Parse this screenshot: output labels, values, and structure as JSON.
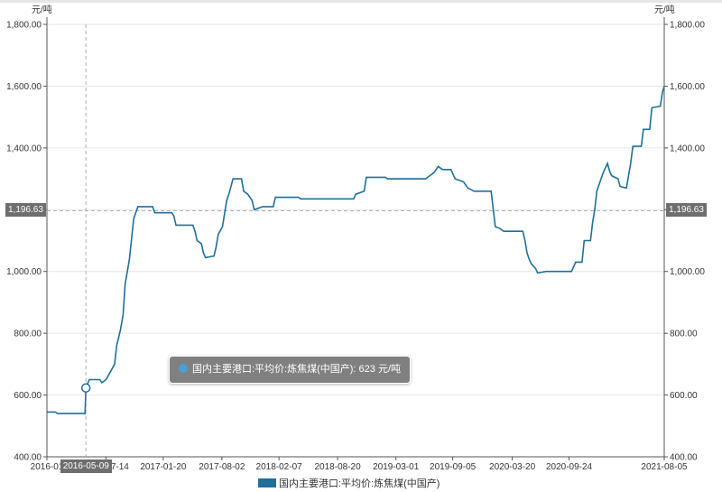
{
  "chart_data": {
    "type": "line",
    "y_unit_left": "元/吨",
    "y_unit_right": "元/吨",
    "ylim": [
      400,
      1800
    ],
    "y_ticks": [
      "400.00",
      "600.00",
      "800.00",
      "1,000.00",
      "1,200.00",
      "1,400.00",
      "1,600.00",
      "1,800.00"
    ],
    "x_ticks": [
      "2016-01",
      "2016-07-14",
      "2017-01-20",
      "2017-08-02",
      "2018-02-07",
      "2018-08-20",
      "2019-03-01",
      "2019-09-05",
      "2020-03-20",
      "2020-09-24",
      "2021-08-05"
    ],
    "x_range": [
      "2016-01-01",
      "2021-08-05"
    ],
    "grid": true,
    "legend_position": "bottom-center",
    "series": [
      {
        "name": "国内主要港口:平均价:炼焦煤(中国产)",
        "color": "#1f6f9c",
        "points": [
          [
            "2016-01-01",
            545
          ],
          [
            "2016-01-29",
            545
          ],
          [
            "2016-02-05",
            540
          ],
          [
            "2016-05-06",
            540
          ],
          [
            "2016-05-09",
            623
          ],
          [
            "2016-05-20",
            650
          ],
          [
            "2016-06-24",
            650
          ],
          [
            "2016-07-01",
            640
          ],
          [
            "2016-07-15",
            650
          ],
          [
            "2016-07-29",
            675
          ],
          [
            "2016-08-12",
            700
          ],
          [
            "2016-08-19",
            760
          ],
          [
            "2016-08-31",
            810
          ],
          [
            "2016-09-09",
            860
          ],
          [
            "2016-09-16",
            960
          ],
          [
            "2016-09-23",
            1000
          ],
          [
            "2016-09-30",
            1040
          ],
          [
            "2016-10-14",
            1170
          ],
          [
            "2016-10-21",
            1190
          ],
          [
            "2016-10-28",
            1210
          ],
          [
            "2016-12-16",
            1210
          ],
          [
            "2016-12-23",
            1190
          ],
          [
            "2017-02-17",
            1190
          ],
          [
            "2017-02-24",
            1180
          ],
          [
            "2017-03-03",
            1150
          ],
          [
            "2017-04-28",
            1150
          ],
          [
            "2017-05-05",
            1130
          ],
          [
            "2017-05-12",
            1100
          ],
          [
            "2017-05-26",
            1090
          ],
          [
            "2017-06-02",
            1060
          ],
          [
            "2017-06-09",
            1045
          ],
          [
            "2017-07-07",
            1050
          ],
          [
            "2017-07-14",
            1080
          ],
          [
            "2017-07-21",
            1120
          ],
          [
            "2017-08-04",
            1145
          ],
          [
            "2017-08-18",
            1230
          ],
          [
            "2017-08-25",
            1250
          ],
          [
            "2017-09-08",
            1300
          ],
          [
            "2017-10-06",
            1300
          ],
          [
            "2017-10-13",
            1260
          ],
          [
            "2017-10-27",
            1250
          ],
          [
            "2017-11-10",
            1230
          ],
          [
            "2017-11-17",
            1200
          ],
          [
            "2017-12-15",
            1210
          ],
          [
            "2018-01-19",
            1210
          ],
          [
            "2018-01-26",
            1240
          ],
          [
            "2018-04-13",
            1240
          ],
          [
            "2018-04-20",
            1235
          ],
          [
            "2018-10-12",
            1235
          ],
          [
            "2018-10-19",
            1250
          ],
          [
            "2018-11-16",
            1260
          ],
          [
            "2018-11-23",
            1305
          ],
          [
            "2019-01-25",
            1305
          ],
          [
            "2019-02-01",
            1300
          ],
          [
            "2019-06-07",
            1300
          ],
          [
            "2019-06-21",
            1310
          ],
          [
            "2019-07-05",
            1320
          ],
          [
            "2019-07-19",
            1340
          ],
          [
            "2019-08-02",
            1330
          ],
          [
            "2019-08-30",
            1330
          ],
          [
            "2019-09-13",
            1300
          ],
          [
            "2019-10-11",
            1290
          ],
          [
            "2019-10-25",
            1270
          ],
          [
            "2019-11-15",
            1260
          ],
          [
            "2020-01-10",
            1260
          ],
          [
            "2020-01-24",
            1145
          ],
          [
            "2020-02-07",
            1140
          ],
          [
            "2020-02-21",
            1130
          ],
          [
            "2020-04-24",
            1130
          ],
          [
            "2020-05-01",
            1100
          ],
          [
            "2020-05-08",
            1060
          ],
          [
            "2020-05-15",
            1040
          ],
          [
            "2020-05-22",
            1025
          ],
          [
            "2020-06-05",
            1010
          ],
          [
            "2020-06-12",
            995
          ],
          [
            "2020-07-10",
            1000
          ],
          [
            "2020-10-02",
            1000
          ],
          [
            "2020-10-16",
            1030
          ],
          [
            "2020-11-06",
            1030
          ],
          [
            "2020-11-13",
            1100
          ],
          [
            "2020-12-04",
            1100
          ],
          [
            "2020-12-11",
            1160
          ],
          [
            "2020-12-18",
            1200
          ],
          [
            "2020-12-25",
            1260
          ],
          [
            "2021-01-08",
            1300
          ],
          [
            "2021-01-15",
            1320
          ],
          [
            "2021-01-29",
            1350
          ],
          [
            "2021-02-05",
            1325
          ],
          [
            "2021-02-12",
            1310
          ],
          [
            "2021-03-05",
            1300
          ],
          [
            "2021-03-12",
            1275
          ],
          [
            "2021-04-02",
            1270
          ],
          [
            "2021-04-16",
            1350
          ],
          [
            "2021-04-23",
            1405
          ],
          [
            "2021-05-21",
            1405
          ],
          [
            "2021-05-28",
            1460
          ],
          [
            "2021-06-18",
            1460
          ],
          [
            "2021-06-25",
            1530
          ],
          [
            "2021-07-23",
            1535
          ],
          [
            "2021-07-30",
            1580
          ],
          [
            "2021-08-05",
            1600
          ]
        ]
      }
    ],
    "crosshair": {
      "x_label": "2016-05-09",
      "y_label": "1,196.63",
      "y_value": 1196.63,
      "x_value": "2016-05-09"
    },
    "tooltip": {
      "text": "国内主要港口:平均价:炼焦煤(中国产): 623 元/吨",
      "point": [
        "2016-05-09",
        623
      ]
    }
  }
}
